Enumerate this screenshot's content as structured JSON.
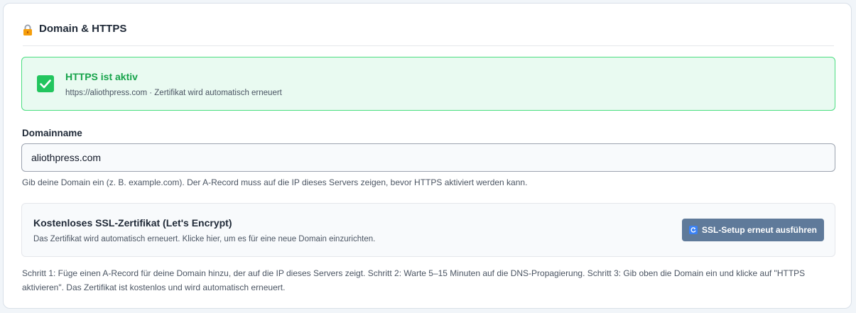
{
  "section": {
    "title": "Domain & HTTPS",
    "icon": "lock-icon"
  },
  "status": {
    "title": "HTTPS ist aktiv",
    "description": "https://aliothpress.com · Zertifikat wird automatisch erneuert",
    "icon": "check-icon",
    "color": "#16a34a"
  },
  "domain_field": {
    "label": "Domainname",
    "value": "aliothpress.com",
    "help": "Gib deine Domain ein (z. B. example.com). Der A-Record muss auf die IP dieses Servers zeigen, bevor HTTPS aktiviert werden kann."
  },
  "ssl": {
    "title": "Kostenloses SSL-Zertifikat (Let's Encrypt)",
    "description": "Das Zertifikat wird automatisch erneuert. Klicke hier, um es für eine neue Domain einzurichten.",
    "button_label": "SSL-Setup erneut ausführen",
    "button_icon": "refresh-icon",
    "button_color": "#5f7a9a"
  },
  "steps": "Schritt 1: Füge einen A-Record für deine Domain hinzu, der auf die IP dieses Servers zeigt. Schritt 2: Warte 5–15 Minuten auf die DNS-Propagierung. Schritt 3: Gib oben die Domain ein und klicke auf \"HTTPS aktivieren\". Das Zertifikat ist kostenlos und wird automatisch erneuert."
}
